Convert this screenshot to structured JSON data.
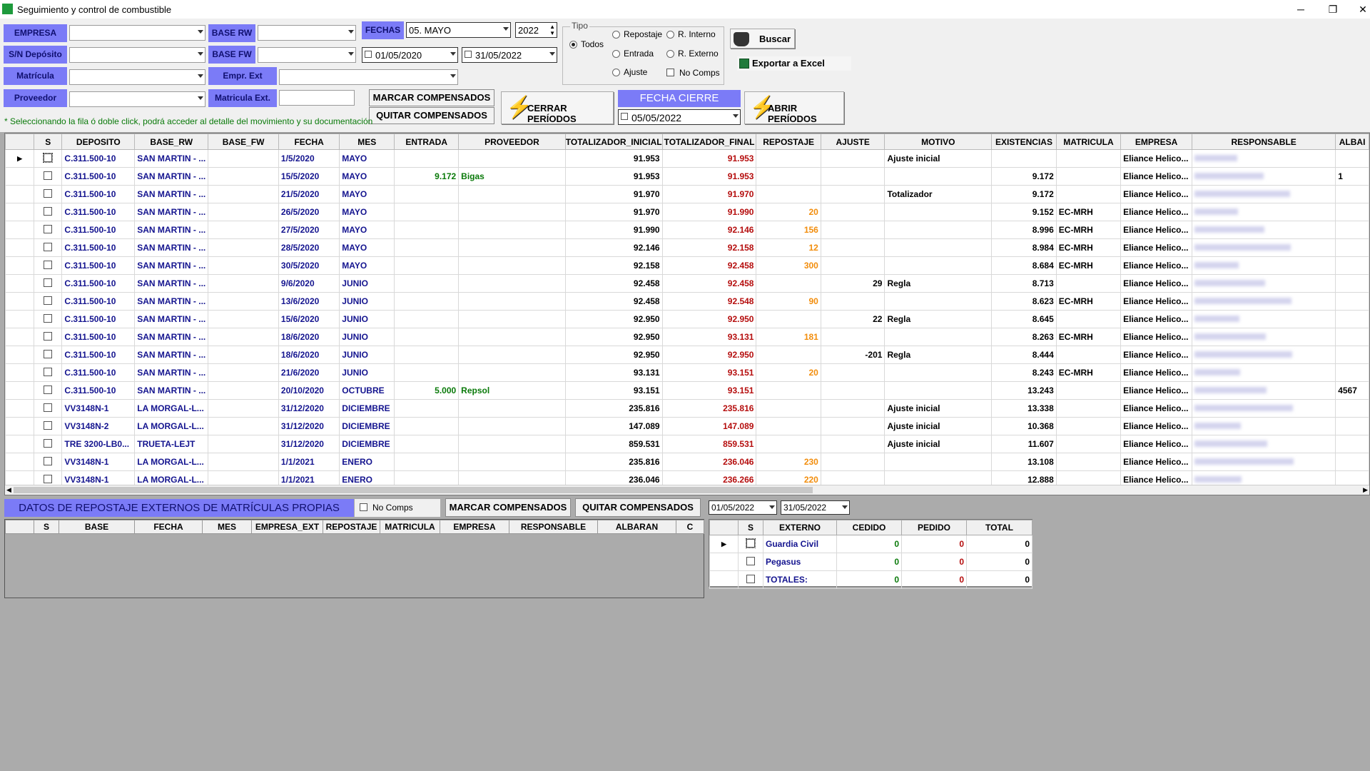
{
  "window": {
    "title": "Seguimiento y control de combustible",
    "btn_min": "─",
    "btn_restore": "❐",
    "btn_close": "✕"
  },
  "filters": {
    "empresa_label": "EMPRESA",
    "sn_deposito_label": "S/N Depósito",
    "matricula_label": "Matrícula",
    "proveedor_label": "Proveedor",
    "base_rw_label": "BASE RW",
    "base_fw_label": "BASE FW",
    "empr_ext_label": "Empr. Ext",
    "matricula_ext_label": "Matricula  Ext.",
    "fechas_label": "FECHAS",
    "month_value": "05. MAYO",
    "year_value": "2022",
    "date_from": "01/05/2020",
    "date_to": "31/05/2022"
  },
  "tipo": {
    "legend": "Tipo",
    "todos": "Todos",
    "repostaje": "Repostaje",
    "r_interno": "R. Interno",
    "entrada": "Entrada",
    "r_externo": "R. Externo",
    "ajuste": "Ajuste",
    "no_comps": "No Comps",
    "selected": "Todos"
  },
  "actions": {
    "buscar": "Buscar",
    "exportar": "Exportar a Excel",
    "marcar": "MARCAR COMPENSADOS",
    "quitar": "QUITAR COMPENSADOS",
    "cerrar": "CERRAR PERÍODOS",
    "abrir": "ABRIR PERÍODOS",
    "fecha_cierre_label": "FECHA CIERRE",
    "fecha_cierre_value": "05/05/2022"
  },
  "hint": "* Seleccionando la fila ó doble click, podrá acceder al detalle del movimiento y su documentación",
  "grid": {
    "columns": [
      "S",
      "DEPOSITO",
      "BASE_RW",
      "BASE_FW",
      "FECHA",
      "MES",
      "ENTRADA",
      "PROVEEDOR",
      "TOTALIZADOR_INICIAL",
      "TOTALIZADOR_FINAL",
      "REPOSTAJE",
      "AJUSTE",
      "MOTIVO",
      "EXISTENCIAS",
      "MATRICULA",
      "EMPRESA",
      "RESPONSABLE",
      "ALBAI"
    ],
    "rows": [
      {
        "dep": "C.311.500-10",
        "rw": "SAN MARTIN - ...",
        "fw": "",
        "fecha": "1/5/2020",
        "mes": "MAYO",
        "entrada": "",
        "prov": "",
        "ti": "91.953",
        "tf": "91.953",
        "rep": "",
        "aj": "",
        "motivo": "Ajuste inicial",
        "exist": "",
        "mat": "",
        "emp": "Eliance Helico...",
        "alb": ""
      },
      {
        "dep": "C.311.500-10",
        "rw": "SAN MARTIN - ...",
        "fw": "",
        "fecha": "15/5/2020",
        "mes": "MAYO",
        "entrada": "9.172",
        "prov": "Bigas",
        "ti": "91.953",
        "tf": "91.953",
        "rep": "",
        "aj": "",
        "motivo": "",
        "exist": "9.172",
        "mat": "",
        "emp": "Eliance Helico...",
        "alb": "1"
      },
      {
        "dep": "C.311.500-10",
        "rw": "SAN MARTIN - ...",
        "fw": "",
        "fecha": "21/5/2020",
        "mes": "MAYO",
        "entrada": "",
        "prov": "",
        "ti": "91.970",
        "tf": "91.970",
        "rep": "",
        "aj": "",
        "motivo": "Totalizador",
        "exist": "9.172",
        "mat": "",
        "emp": "Eliance Helico...",
        "alb": ""
      },
      {
        "dep": "C.311.500-10",
        "rw": "SAN MARTIN - ...",
        "fw": "",
        "fecha": "26/5/2020",
        "mes": "MAYO",
        "entrada": "",
        "prov": "",
        "ti": "91.970",
        "tf": "91.990",
        "rep": "20",
        "aj": "",
        "motivo": "",
        "exist": "9.152",
        "mat": "EC-MRH",
        "emp": "Eliance Helico...",
        "alb": ""
      },
      {
        "dep": "C.311.500-10",
        "rw": "SAN MARTIN - ...",
        "fw": "",
        "fecha": "27/5/2020",
        "mes": "MAYO",
        "entrada": "",
        "prov": "",
        "ti": "91.990",
        "tf": "92.146",
        "rep": "156",
        "aj": "",
        "motivo": "",
        "exist": "8.996",
        "mat": "EC-MRH",
        "emp": "Eliance Helico...",
        "alb": ""
      },
      {
        "dep": "C.311.500-10",
        "rw": "SAN MARTIN - ...",
        "fw": "",
        "fecha": "28/5/2020",
        "mes": "MAYO",
        "entrada": "",
        "prov": "",
        "ti": "92.146",
        "tf": "92.158",
        "rep": "12",
        "aj": "",
        "motivo": "",
        "exist": "8.984",
        "mat": "EC-MRH",
        "emp": "Eliance Helico...",
        "alb": ""
      },
      {
        "dep": "C.311.500-10",
        "rw": "SAN MARTIN - ...",
        "fw": "",
        "fecha": "30/5/2020",
        "mes": "MAYO",
        "entrada": "",
        "prov": "",
        "ti": "92.158",
        "tf": "92.458",
        "rep": "300",
        "aj": "",
        "motivo": "",
        "exist": "8.684",
        "mat": "EC-MRH",
        "emp": "Eliance Helico...",
        "alb": ""
      },
      {
        "dep": "C.311.500-10",
        "rw": "SAN MARTIN - ...",
        "fw": "",
        "fecha": "9/6/2020",
        "mes": "JUNIO",
        "entrada": "",
        "prov": "",
        "ti": "92.458",
        "tf": "92.458",
        "rep": "",
        "aj": "29",
        "motivo": "Regla",
        "exist": "8.713",
        "mat": "",
        "emp": "Eliance Helico...",
        "alb": ""
      },
      {
        "dep": "C.311.500-10",
        "rw": "SAN MARTIN - ...",
        "fw": "",
        "fecha": "13/6/2020",
        "mes": "JUNIO",
        "entrada": "",
        "prov": "",
        "ti": "92.458",
        "tf": "92.548",
        "rep": "90",
        "aj": "",
        "motivo": "",
        "exist": "8.623",
        "mat": "EC-MRH",
        "emp": "Eliance Helico...",
        "alb": ""
      },
      {
        "dep": "C.311.500-10",
        "rw": "SAN MARTIN - ...",
        "fw": "",
        "fecha": "15/6/2020",
        "mes": "JUNIO",
        "entrada": "",
        "prov": "",
        "ti": "92.950",
        "tf": "92.950",
        "rep": "",
        "aj": "22",
        "motivo": "Regla",
        "exist": "8.645",
        "mat": "",
        "emp": "Eliance Helico...",
        "alb": ""
      },
      {
        "dep": "C.311.500-10",
        "rw": "SAN MARTIN - ...",
        "fw": "",
        "fecha": "18/6/2020",
        "mes": "JUNIO",
        "entrada": "",
        "prov": "",
        "ti": "92.950",
        "tf": "93.131",
        "rep": "181",
        "aj": "",
        "motivo": "",
        "exist": "8.263",
        "mat": "EC-MRH",
        "emp": "Eliance Helico...",
        "alb": ""
      },
      {
        "dep": "C.311.500-10",
        "rw": "SAN MARTIN - ...",
        "fw": "",
        "fecha": "18/6/2020",
        "mes": "JUNIO",
        "entrada": "",
        "prov": "",
        "ti": "92.950",
        "tf": "92.950",
        "rep": "",
        "aj": "-201",
        "motivo": "Regla",
        "exist": "8.444",
        "mat": "",
        "emp": "Eliance Helico...",
        "alb": ""
      },
      {
        "dep": "C.311.500-10",
        "rw": "SAN MARTIN - ...",
        "fw": "",
        "fecha": "21/6/2020",
        "mes": "JUNIO",
        "entrada": "",
        "prov": "",
        "ti": "93.131",
        "tf": "93.151",
        "rep": "20",
        "aj": "",
        "motivo": "",
        "exist": "8.243",
        "mat": "EC-MRH",
        "emp": "Eliance Helico...",
        "alb": ""
      },
      {
        "dep": "C.311.500-10",
        "rw": "SAN MARTIN - ...",
        "fw": "",
        "fecha": "20/10/2020",
        "mes": "OCTUBRE",
        "entrada": "5.000",
        "prov": "Repsol",
        "ti": "93.151",
        "tf": "93.151",
        "rep": "",
        "aj": "",
        "motivo": "",
        "exist": "13.243",
        "mat": "",
        "emp": "Eliance Helico...",
        "alb": "4567"
      },
      {
        "dep": "VV3148N-1",
        "rw": "LA MORGAL-L...",
        "fw": "",
        "fecha": "31/12/2020",
        "mes": "DICIEMBRE",
        "entrada": "",
        "prov": "",
        "ti": "235.816",
        "tf": "235.816",
        "rep": "",
        "aj": "",
        "motivo": "Ajuste inicial",
        "exist": "13.338",
        "mat": "",
        "emp": "Eliance Helico...",
        "alb": ""
      },
      {
        "dep": "VV3148N-2",
        "rw": "LA MORGAL-L...",
        "fw": "",
        "fecha": "31/12/2020",
        "mes": "DICIEMBRE",
        "entrada": "",
        "prov": "",
        "ti": "147.089",
        "tf": "147.089",
        "rep": "",
        "aj": "",
        "motivo": "Ajuste inicial",
        "exist": "10.368",
        "mat": "",
        "emp": "Eliance Helico...",
        "alb": ""
      },
      {
        "dep": "TRE 3200-LB0...",
        "rw": "TRUETA-LEJT",
        "fw": "",
        "fecha": "31/12/2020",
        "mes": "DICIEMBRE",
        "entrada": "",
        "prov": "",
        "ti": "859.531",
        "tf": "859.531",
        "rep": "",
        "aj": "",
        "motivo": "Ajuste inicial",
        "exist": "11.607",
        "mat": "",
        "emp": "Eliance Helico...",
        "alb": ""
      },
      {
        "dep": "VV3148N-1",
        "rw": "LA MORGAL-L...",
        "fw": "",
        "fecha": "1/1/2021",
        "mes": "ENERO",
        "entrada": "",
        "prov": "",
        "ti": "235.816",
        "tf": "236.046",
        "rep": "230",
        "aj": "",
        "motivo": "",
        "exist": "13.108",
        "mat": "",
        "emp": "Eliance Helico...",
        "alb": ""
      },
      {
        "dep": "VV3148N-1",
        "rw": "LA MORGAL-L...",
        "fw": "",
        "fecha": "1/1/2021",
        "mes": "ENERO",
        "entrada": "",
        "prov": "",
        "ti": "236.046",
        "tf": "236.266",
        "rep": "220",
        "aj": "",
        "motivo": "",
        "exist": "12.888",
        "mat": "",
        "emp": "Eliance Helico...",
        "alb": ""
      }
    ]
  },
  "externos": {
    "title": "DATOS DE REPOSTAJE EXTERNOS DE MATRÍCULAS PROPIAS",
    "no_comps": "No Comps",
    "marcar": "MARCAR COMPENSADOS",
    "quitar": "QUITAR COMPENSADOS",
    "date_from": "01/05/2022",
    "date_to": "31/05/2022",
    "columns": [
      "S",
      "BASE",
      "FECHA",
      "MES",
      "EMPRESA_EXT",
      "REPOSTAJE",
      "MATRICULA",
      "EMPRESA",
      "RESPONSABLE",
      "ALBARAN",
      "C"
    ]
  },
  "summary": {
    "columns": [
      "S",
      "EXTERNO",
      "CEDIDO",
      "PEDIDO",
      "TOTAL"
    ],
    "rows": [
      {
        "externo": "Guardia Civil",
        "cedido": "0",
        "pedido": "0",
        "total": "0"
      },
      {
        "externo": "Pegasus",
        "cedido": "0",
        "pedido": "0",
        "total": "0"
      },
      {
        "externo": "TOTALES:",
        "cedido": "0",
        "pedido": "0",
        "total": "0"
      }
    ]
  }
}
